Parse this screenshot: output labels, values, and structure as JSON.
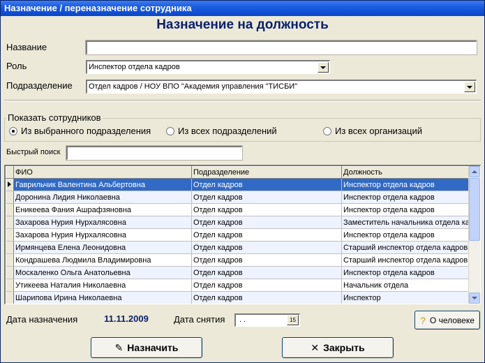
{
  "window": {
    "title": "Назначение / переназначение сотрудника"
  },
  "heading": "Назначение на должность",
  "form": {
    "name_label": "Название",
    "name_value": "",
    "role_label": "Роль",
    "role_value": "Инспектор отдела кадров",
    "dept_label": "Подразделение",
    "dept_value": "Отдел кадров / НОУ ВПО \"Академия управления \"ТИСБИ\""
  },
  "show_group": {
    "title": "Показать сотрудников",
    "options": [
      {
        "label": "Из выбранного подразделения",
        "selected": true
      },
      {
        "label": "Из всех подразделений",
        "selected": false
      },
      {
        "label": "Из всех организаций",
        "selected": false
      }
    ]
  },
  "search": {
    "label": "Быстрый поиск",
    "value": ""
  },
  "table": {
    "columns": [
      "ФИО",
      "Подразделение",
      "Должность"
    ],
    "rows": [
      [
        "Гаврильчик Валентина Альбертовна",
        "Отдел кадров",
        "Инспектор отдела кадров"
      ],
      [
        "Доронина Лидия Николаевна",
        "Отдел кадров",
        "Инспектор отдела кадров"
      ],
      [
        "Еникеева Фания Ашрафзяновна",
        "Отдел кадров",
        "Инспектор отдела кадров"
      ],
      [
        "Захарова Нурия Нурхалясовна",
        "Отдел кадров",
        "Заместитель начальника отдела ка"
      ],
      [
        "Захарова Нурия Нурхалясовна",
        "Отдел кадров",
        "Инспектор отдела кадров"
      ],
      [
        "Ирмянцева Елена Леонидовна",
        "Отдел кадров",
        "Старший инспектор отдела кадров"
      ],
      [
        "Кондрашева Людмила Владимировна",
        "Отдел кадров",
        "Старший инспектор отдела кадров"
      ],
      [
        "Москаленко Ольга Анатольевна",
        "Отдел кадров",
        "Инспектор отдела кадров"
      ],
      [
        "Утикеева Наталия Николаевна",
        "Отдел кадров",
        "Начальник отдела"
      ],
      [
        "Шарипова Ирина Николаевна",
        "Отдел кадров",
        "Инспектор"
      ]
    ],
    "selected_row": 0
  },
  "dates": {
    "assign_label": "Дата назначения",
    "assign_value": "11.11.2009",
    "remove_label": "Дата снятия",
    "remove_value": ". .",
    "calendar_btn": "15"
  },
  "buttons": {
    "about_person": "О человеке",
    "assign": "Назначить",
    "close": "Закрыть"
  },
  "colors": {
    "title_bar": "#0a47c7",
    "heading": "#0a1f6e",
    "selection": "#316ac5",
    "background": "#ece9d8"
  }
}
